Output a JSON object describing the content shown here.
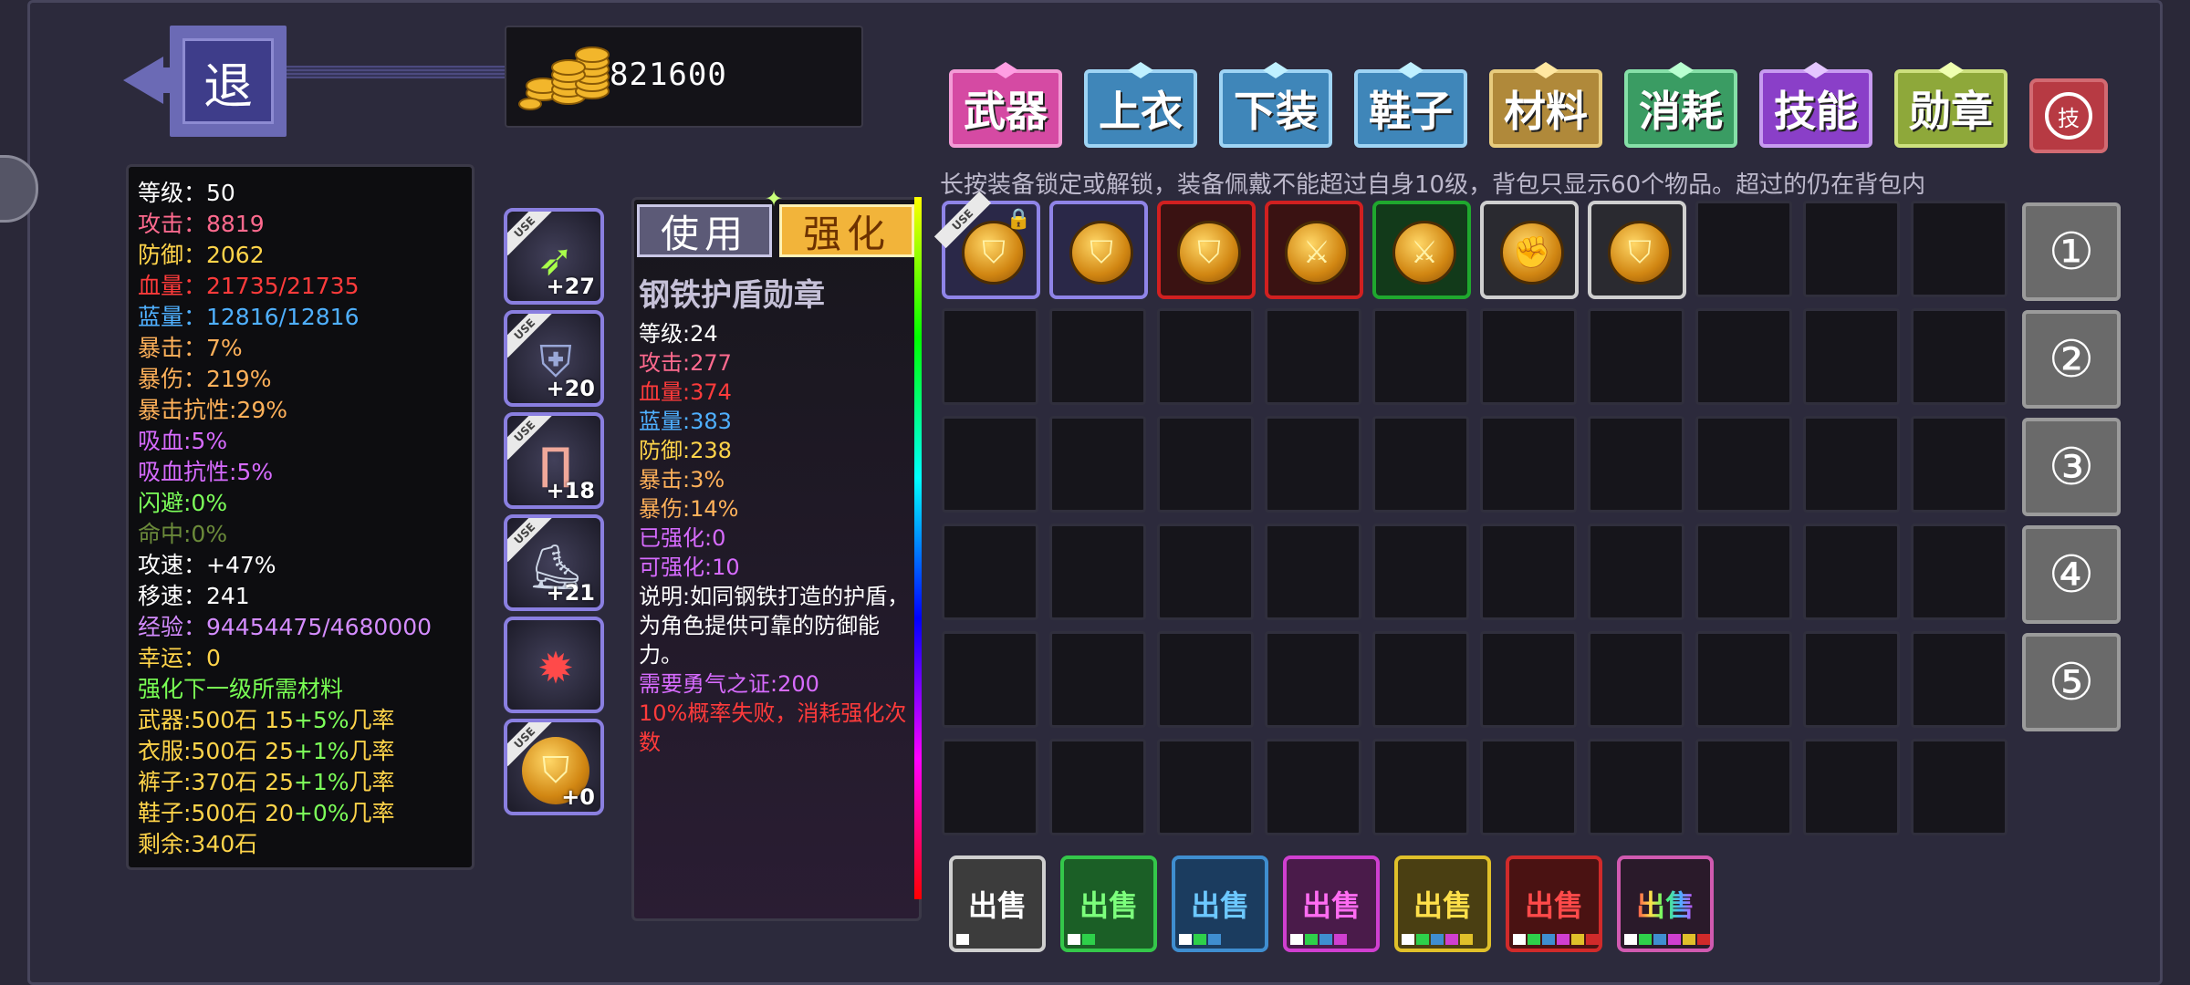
{
  "header": {
    "back_label": "退",
    "gold": "821600"
  },
  "stats": [
    {
      "label": "等级：50",
      "color": "w"
    },
    {
      "label": "攻击：8819",
      "color": "p"
    },
    {
      "label": "防御：2062",
      "color": "y"
    },
    {
      "label": "血量：21735/21735",
      "color": "r"
    },
    {
      "label": "蓝量：12816/12816",
      "color": "b"
    },
    {
      "label": "暴击：7%",
      "color": "o"
    },
    {
      "label": "暴伤：219%",
      "color": "o"
    },
    {
      "label": "暴击抗性:29%",
      "color": "o"
    },
    {
      "label": "吸血:5%",
      "color": "m"
    },
    {
      "label": "吸血抗性:5%",
      "color": "m"
    },
    {
      "label": "闪避:0%",
      "color": "g"
    },
    {
      "label": "命中:0%",
      "color": "dg"
    },
    {
      "label": "攻速：+47%",
      "color": "w"
    },
    {
      "label": "移速：241",
      "color": "w"
    },
    {
      "label": "经验：94454475/4680000",
      "color": "lp"
    },
    {
      "label": "幸运：0",
      "color": "y"
    },
    {
      "label": "强化下一级所需材料",
      "color": "gr"
    }
  ],
  "materials": [
    {
      "prefix": "武器:500石 15",
      "rate": "+5%",
      "suffix": "几率"
    },
    {
      "prefix": "衣服:500石 25",
      "rate": "+1%",
      "suffix": "几率"
    },
    {
      "prefix": "裤子:370石 25",
      "rate": "+1%",
      "suffix": "几率"
    },
    {
      "prefix": "鞋子:500石 20",
      "rate": "+0%",
      "suffix": "几率"
    }
  ],
  "remaining": "剩余:340石",
  "equipped": [
    {
      "level": "+27",
      "icon": "crossbow-icon",
      "glyph": "➶",
      "use": "USE"
    },
    {
      "level": "+20",
      "icon": "robe-icon",
      "glyph": "⛨",
      "use": "USE"
    },
    {
      "level": "+18",
      "icon": "pants-icon",
      "glyph": "∏",
      "use": "USE"
    },
    {
      "level": "+21",
      "icon": "boots-icon",
      "glyph": "⛸",
      "use": "USE"
    },
    {
      "level": "",
      "icon": "pet-icon",
      "glyph": "✹",
      "use": ""
    },
    {
      "level": "+0",
      "icon": "shield-medal-icon",
      "glyph": "⛉",
      "use": "USE"
    }
  ],
  "detail": {
    "tab_use": "使用",
    "tab_enhance": "强化",
    "name": "钢铁护盾勋章",
    "lines": [
      {
        "text": "等级:24",
        "color": "w"
      },
      {
        "text": "攻击:277",
        "color": "p"
      },
      {
        "text": "血量:374",
        "color": "r"
      },
      {
        "text": "蓝量:383",
        "color": "b"
      },
      {
        "text": "防御:238",
        "color": "y"
      },
      {
        "text": "暴击:3%",
        "color": "o"
      },
      {
        "text": "暴伤:14%",
        "color": "o"
      },
      {
        "text": "已强化:0",
        "color": "m"
      },
      {
        "text": "可强化:10",
        "color": "m"
      }
    ],
    "description": "说明:如同钢铁打造的护盾，为角色提供可靠的防御能力。",
    "requirement": "需要勇气之证:200",
    "warning": "10%概率失败，消耗强化次数"
  },
  "categories": [
    {
      "label": "武器",
      "bg": "#d54aa3",
      "border": "#f39bd6",
      "gem": "#ff9ee3"
    },
    {
      "label": "上衣",
      "bg": "#3f86b9",
      "border": "#9fd4f4",
      "gem": "#bff0ff"
    },
    {
      "label": "下装",
      "bg": "#3f86b9",
      "border": "#9fd4f4",
      "gem": "#bff0ff"
    },
    {
      "label": "鞋子",
      "bg": "#3f86b9",
      "border": "#9fd4f4",
      "gem": "#bff0ff"
    },
    {
      "label": "材料",
      "bg": "#b0893a",
      "border": "#e8cc7e",
      "gem": "#ffe7a0"
    },
    {
      "label": "消耗",
      "bg": "#3a9c63",
      "border": "#86e0a8",
      "gem": "#b8ffd0"
    },
    {
      "label": "技能",
      "bg": "#8a3fc8",
      "border": "#c79bf0",
      "gem": "#e4c6ff"
    },
    {
      "label": "勋章",
      "bg": "#8ea83a",
      "border": "#cde07e",
      "gem": "#efffb0"
    }
  ],
  "refresh_label": "技",
  "hint": "长按装备锁定或解锁，装备佩戴不能超过自身10级，背包只显示60个物品。超过的仍在背包内",
  "inventory": [
    {
      "border": "#8f84e8",
      "glyph": "⛉",
      "use": "USE",
      "lock": "🔒"
    },
    {
      "border": "#8f84e8",
      "glyph": "⛉",
      "use": "",
      "lock": ""
    },
    {
      "border": "#d12020",
      "glyph": "⛉",
      "use": "",
      "lock": ""
    },
    {
      "border": "#d12020",
      "glyph": "⚔",
      "use": "",
      "lock": ""
    },
    {
      "border": "#1fa82e",
      "glyph": "⚔",
      "use": "",
      "lock": ""
    },
    {
      "border": "#cfcfcf",
      "glyph": "✊",
      "use": "",
      "lock": ""
    },
    {
      "border": "#cfcfcf",
      "glyph": "⛉",
      "use": "",
      "lock": ""
    }
  ],
  "loadouts": [
    "①",
    "②",
    "③",
    "④",
    "⑤"
  ],
  "sell_buttons": [
    {
      "label": "出售",
      "bg": "#3c3c3c",
      "border": "#cfcfcf",
      "text": "#ffffff",
      "dots": [
        "#ffffff"
      ]
    },
    {
      "label": "出售",
      "bg": "#1b5f26",
      "border": "#34c74a",
      "text": "#7cff7c",
      "dots": [
        "#ffffff",
        "#2ed04a"
      ]
    },
    {
      "label": "出售",
      "bg": "#1b3c5f",
      "border": "#3f8ed0",
      "text": "#6cc8ff",
      "dots": [
        "#ffffff",
        "#2ed04a",
        "#3f8ed0"
      ]
    },
    {
      "label": "出售",
      "bg": "#4a1b4a",
      "border": "#d03fd0",
      "text": "#ff6cf2",
      "dots": [
        "#ffffff",
        "#2ed04a",
        "#3f8ed0",
        "#d03fd0"
      ]
    },
    {
      "label": "出售",
      "bg": "#4a3f12",
      "border": "#e0c02a",
      "text": "#ffe04a",
      "dots": [
        "#ffffff",
        "#2ed04a",
        "#3f8ed0",
        "#d03fd0",
        "#e0c02a"
      ]
    },
    {
      "label": "出售",
      "bg": "#4a1212",
      "border": "#d02a2a",
      "text": "#ff4a4a",
      "dots": [
        "#ffffff",
        "#2ed04a",
        "#3f8ed0",
        "#d03fd0",
        "#e0c02a",
        "#d02a2a"
      ]
    },
    {
      "label": "出售",
      "bg": "#2a1a2a",
      "border": "#d05ab0",
      "text": "rainbow",
      "dots": [
        "#ffffff",
        "#2ed04a",
        "#3f8ed0",
        "#d03fd0",
        "#e0c02a",
        "#d02a2a"
      ]
    }
  ]
}
